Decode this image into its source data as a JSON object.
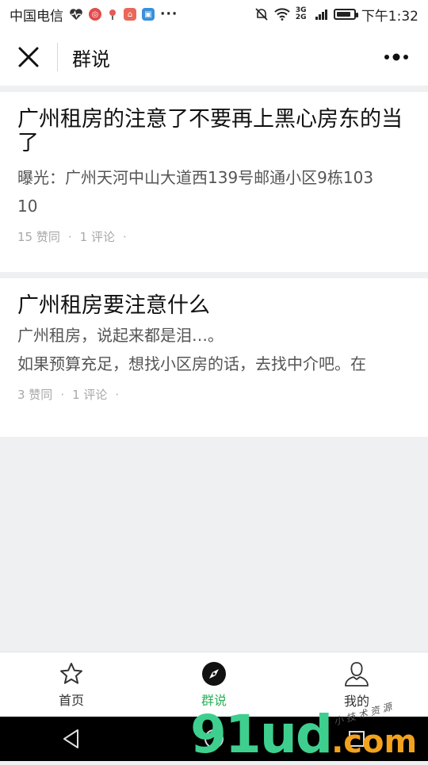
{
  "status_bar": {
    "carrier": "中国电信",
    "more": "···",
    "time": "下午1:32",
    "network": "3G 2G",
    "battery_level": 0.85
  },
  "navbar": {
    "title": "群说"
  },
  "posts": [
    {
      "title": "广州租房的注意了不要再上黑心房东的当了",
      "body": [
        "曝光：广州天河中山大道西139号邮通小区9栋103",
        "10"
      ],
      "likes": "15 赞同",
      "comments": "1 评论",
      "dot": "·"
    },
    {
      "title": "广州租房要注意什么",
      "body": [
        "广州租房，说起来都是泪…。",
        "如果预算充足，想找小区房的话，去找中介吧。在"
      ],
      "likes": "3 赞同",
      "comments": "1 评论",
      "dot": "·"
    }
  ],
  "tabbar": {
    "tabs": [
      {
        "label": "首页",
        "icon": "star-icon"
      },
      {
        "label": "群说",
        "icon": "compass-icon",
        "active": true
      },
      {
        "label": "我的",
        "icon": "user-icon"
      }
    ],
    "active_color": "#2fb05a"
  },
  "watermark": {
    "number": "91ud",
    "domain": ".com",
    "script": "小 技 术 资 源"
  }
}
